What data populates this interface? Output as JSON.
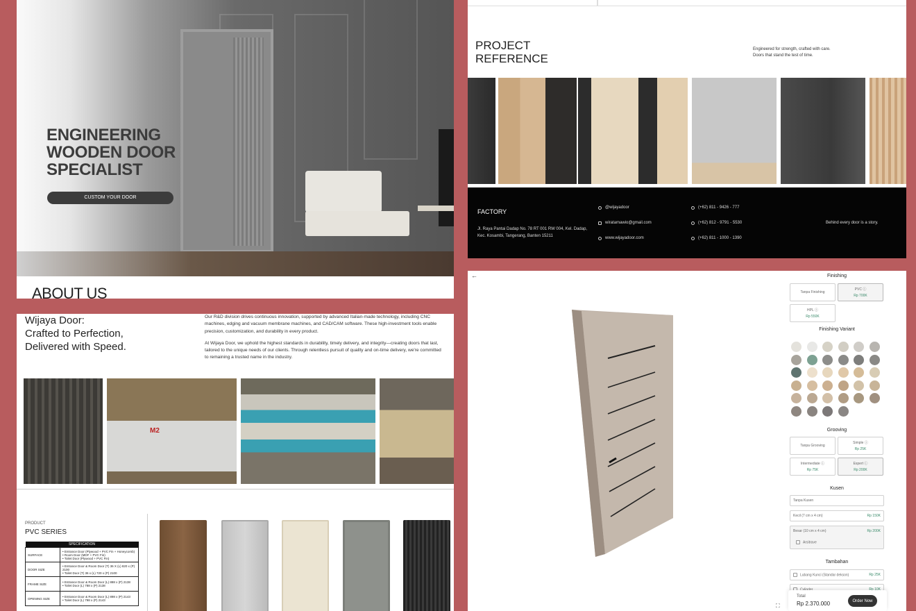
{
  "hero": {
    "headline": "ENGINEERING\nWOODEN DOOR\nSPECIALIST",
    "cta_label": "CUSTOM YOUR DOOR",
    "about_heading": "ABOUT US"
  },
  "project": {
    "title": "PROJECT\nREFERENCE",
    "tagline_1": "Engineered for strength, crafted with care.",
    "tagline_2": "Doors that stand the test of time.",
    "footer": {
      "factory_label": "FACTORY",
      "address_1": "Jl. Raya Pantai Dadap No. 78 RT 001 RW 004, Kel. Dadap,",
      "address_2": "Kec. Kosambi, Tangerang, Banten 15211",
      "instagram": "@wijayadoor",
      "email": "wiratamawio@gmail.com",
      "website": "www.wijayadoor.com",
      "phone_1": "(+62) 811 - 9426 - 777",
      "phone_2": "(+62) 812 - 9791 - 5530",
      "phone_3": "(+62) 811 - 1000 - 1390",
      "story": "Behind every door is a story."
    }
  },
  "factory": {
    "heading": "Wijaya Door:\nCrafted to Perfection,\nDelivered with Speed.",
    "para_1": "Our R&D division drives continuous innovation, supported by advanced Italian-made technology, including CNC machines, edging and vacuum membrane machines, and CAD/CAM software. These high-investment tools enable precision, customization, and durability in every product.",
    "para_2": "At Wijaya Door, we uphold the highest standards in durability, timely delivery, and integrity—creating doors that last, tailored to the unique needs of our clients. Through relentless pursuit of quality and on-time delivery, we're committed to remaining a trusted name in the industry.",
    "machine_label": "M2",
    "product_label": "PRODUCT",
    "series": "PVC SERIES",
    "spec_header": "SPECIFICATION",
    "spec": [
      {
        "k": "SURFACE",
        "v": "• Entrance Door (Plywood + PVC Fin + Honeycomb)\n• Room Door (MDF + PVC Fin)\n• Toilet Door (Plywood + PVC Fin)"
      },
      {
        "k": "DOOR SIZE",
        "v": "• Entrance Door & Room Door (T) 36 X (L) 820 x (P) 2100\n• Toilet Door (T) 36 x (L) 720 x (P) 2100"
      },
      {
        "k": "FRAME SIZE",
        "v": "• Entrance Door & Room Door (L) 888 x (P) 2138\n• Toilet Door (L) 788 x (P) 2138"
      },
      {
        "k": "OPENING SIZE",
        "v": "• Entrance Door & Room Door (L) 898 x (P) 2143\n• Toilet Door (L) 798 x (P) 2143"
      }
    ]
  },
  "config": {
    "back_icon": "arrow-left-icon",
    "finishing_title": "Finishing",
    "finishing": [
      {
        "label": "Tanpa Finishing",
        "price": ""
      },
      {
        "label": "PVC",
        "price": "Rp 700K"
      },
      {
        "label": "HPL",
        "price": "Rp 550K"
      }
    ],
    "variant_title": "Finishing Variant",
    "swatches": [
      "#e4e2dc",
      "#e8e8e6",
      "#d6d2c6",
      "#d2cec4",
      "#d0cdc8",
      "#b8b5b0",
      "#a8a49c",
      "#7da192",
      "#8d8d8a",
      "#8a8a88",
      "#7e7e7c",
      "#8a8986",
      "#5f7470",
      "#ede0cc",
      "#e7d7bd",
      "#e0c8a8",
      "#d5bc98",
      "#d8ccb4",
      "#c8b090",
      "#d6bea0",
      "#ccb090",
      "#bfa486",
      "#d2c2a8",
      "#c8b498",
      "#c6b29c",
      "#bba892",
      "#d3c0a8",
      "#b09c84",
      "#a89880",
      "#a09080",
      "#8e8680",
      "#8a8480",
      "#7c7878",
      "#8a8684"
    ],
    "grooving_title": "Grooving",
    "grooving": [
      {
        "label": "Tanpa Grooving",
        "price": ""
      },
      {
        "label": "Simple",
        "price": "Rp 25K"
      },
      {
        "label": "Intermediate",
        "price": "Rp 75K"
      },
      {
        "label": "Expert",
        "price": "Rp 200K"
      }
    ],
    "kusen_title": "Kusen",
    "kusen": [
      {
        "label": "Tanpa Kusen",
        "price": ""
      },
      {
        "label": "Kecil (7 cm x 4 cm)",
        "price": "Rp 150K"
      },
      {
        "label": "Besar (10 cm x 4 cm)",
        "price": "Rp 200K"
      }
    ],
    "arsitrave": "Arsitrave",
    "tambahan_title": "Tambahan",
    "tambahan": [
      {
        "label": "Lubang Kunci (Standar dekson)",
        "price": "Rp 25K"
      },
      {
        "label": "Cylinder",
        "price": "Rp 10K"
      }
    ],
    "total_label": "Total",
    "total_value": "Rp 2.370.000",
    "order_label": "Order Now",
    "expand_icon": "expand-icon"
  }
}
